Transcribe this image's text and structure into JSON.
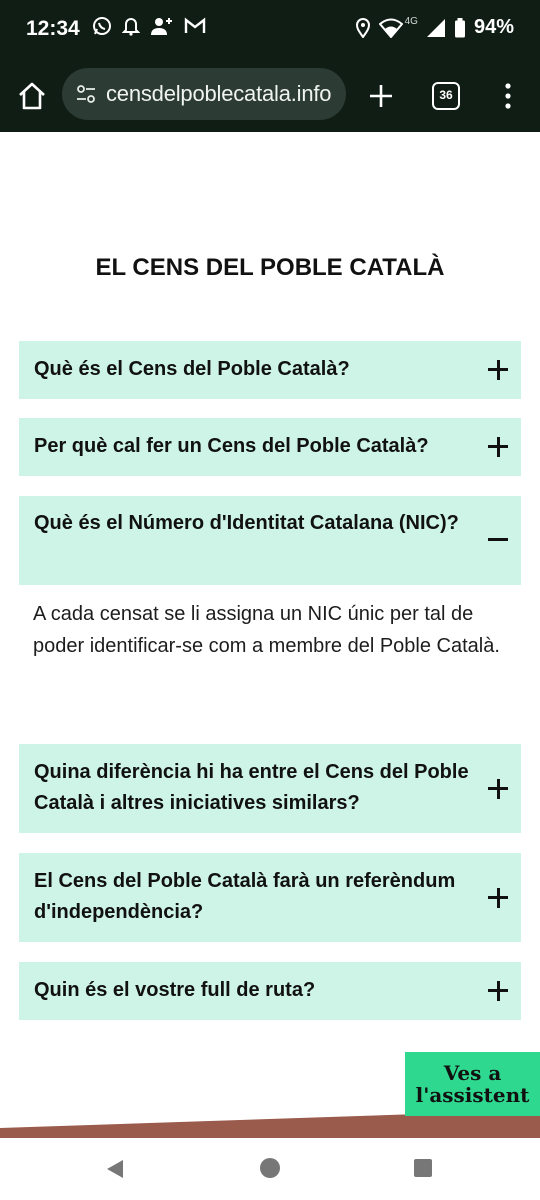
{
  "status_bar": {
    "time": "12:34",
    "network_label": "4G",
    "battery": "94%",
    "icons": [
      "whatsapp-icon",
      "bell-icon",
      "person-add-icon",
      "gmail-icon",
      "location-icon",
      "wifi-icon",
      "signal-icon",
      "battery-icon"
    ]
  },
  "browser": {
    "url": "censdelpoblecatala.info",
    "tab_count": "36"
  },
  "page": {
    "title": "EL CENS DEL POBLE CATALÀ"
  },
  "faq": {
    "items": [
      {
        "question": "Què és el Cens del Poble Català?",
        "expanded": false
      },
      {
        "question": "Per què cal fer un Cens del Poble Català?",
        "expanded": false
      },
      {
        "question": "Què és el Número d'Identitat Catalana (NIC)?",
        "expanded": true,
        "answer": "A cada censat se li assigna un NIC únic per tal de poder identificar-se com a membre del Poble Català."
      },
      {
        "question": "Quina diferència hi ha entre el Cens del Poble Català i altres iniciatives similars?",
        "expanded": false
      },
      {
        "question": "El Cens del Poble Català farà un referèndum d'independència?",
        "expanded": false
      },
      {
        "question": "Quin és el vostre full de ruta?",
        "expanded": false
      }
    ]
  },
  "assistant": {
    "label": "Ves a l'assistent"
  },
  "colors": {
    "faq_background": "#cdf4e6",
    "assistant_background": "#2ed88f",
    "browser_chrome": "#0f1d15",
    "decor_band": "#9a5a4c"
  }
}
